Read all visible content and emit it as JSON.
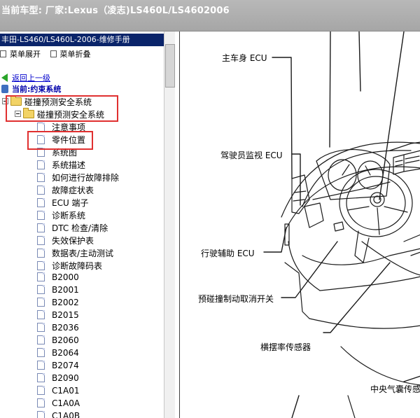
{
  "title_bar": {
    "text": "当前车型:  厂家:Lexus（凌志)LS460L/LS4602006"
  },
  "left_pane": {
    "manual_title": "丰田-LS460/LS460L-2006-维修手册",
    "toolbar": {
      "expand": "菜单展开",
      "collapse": "菜单折叠"
    },
    "back_link": "返回上一级",
    "current": "当前:约束系统",
    "tree": {
      "folder1": "碰撞预测安全系统",
      "folder2": "碰撞预测安全系统",
      "items": [
        "注意事项",
        "零件位置",
        "系统图",
        "系统描述",
        "如何进行故障排除",
        "故障症状表",
        "ECU 端子",
        "诊断系统",
        "DTC 检查/清除",
        "失效保护表",
        "数据表/主动测试",
        "诊断故障码表",
        "B2000",
        "B2001",
        "B2002",
        "B2015",
        "B2036",
        "B2060",
        "B2064",
        "B2074",
        "B2090",
        "C1A01",
        "C1A0A",
        "C1A0B"
      ],
      "selected_item": "零件位置"
    }
  },
  "diagram": {
    "labels": {
      "main_body_ecu": "主车身 ECU",
      "driver_monitor_ecu": "驾驶员监视 ECU",
      "driving_support_ecu": "行驶辅助  ECU",
      "pre_crash_brake_cancel_switch": "预碰撞制动取消开关",
      "yaw_rate_sensor": "横摆率传感器",
      "center_airbag_sensor": "中央气囊传感"
    }
  }
}
